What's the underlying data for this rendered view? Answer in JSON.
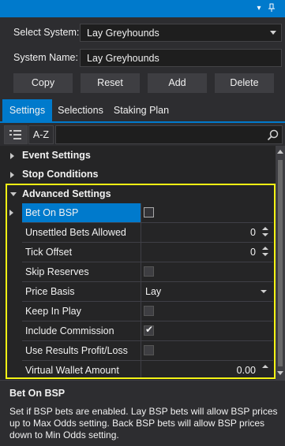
{
  "form": {
    "select_system_label": "Select System:",
    "select_system_value": "Lay Greyhounds",
    "system_name_label": "System Name:",
    "system_name_value": "Lay Greyhounds"
  },
  "buttons": {
    "copy": "Copy",
    "reset": "Reset",
    "add": "Add",
    "delete": "Delete"
  },
  "tabs": [
    {
      "label": "Settings",
      "active": true
    },
    {
      "label": "Selections",
      "active": false
    },
    {
      "label": "Staking Plan",
      "active": false
    }
  ],
  "toolbar": {
    "sort_az": "A-Z",
    "search_placeholder": ""
  },
  "categories": {
    "event_settings": "Event Settings",
    "stop_conditions": "Stop Conditions",
    "advanced_settings": "Advanced Settings"
  },
  "properties": [
    {
      "name": "Bet On BSP",
      "type": "checkbox",
      "checked": false,
      "selected": true
    },
    {
      "name": "Unsettled Bets Allowed",
      "type": "number",
      "value": "0"
    },
    {
      "name": "Tick Offset",
      "type": "number",
      "value": "0"
    },
    {
      "name": "Skip Reserves",
      "type": "checkbox",
      "checked": false
    },
    {
      "name": "Price Basis",
      "type": "select",
      "value": "Lay"
    },
    {
      "name": "Keep In Play",
      "type": "checkbox",
      "checked": false
    },
    {
      "name": "Include Commission",
      "type": "checkbox",
      "checked": true
    },
    {
      "name": "Use Results Profit/Loss",
      "type": "checkbox",
      "checked": false
    },
    {
      "name": "Virtual Wallet Amount",
      "type": "number",
      "value": "0.00"
    }
  ],
  "description": {
    "title": "Bet On BSP",
    "text": "Set if BSP bets are enabled. Lay BSP bets will allow BSP prices up to Max Odds setting. Back BSP bets will allow BSP prices down to Min Odds setting."
  },
  "colors": {
    "accent": "#007acc",
    "highlight": "#f4f414",
    "background": "#2d2d30"
  }
}
